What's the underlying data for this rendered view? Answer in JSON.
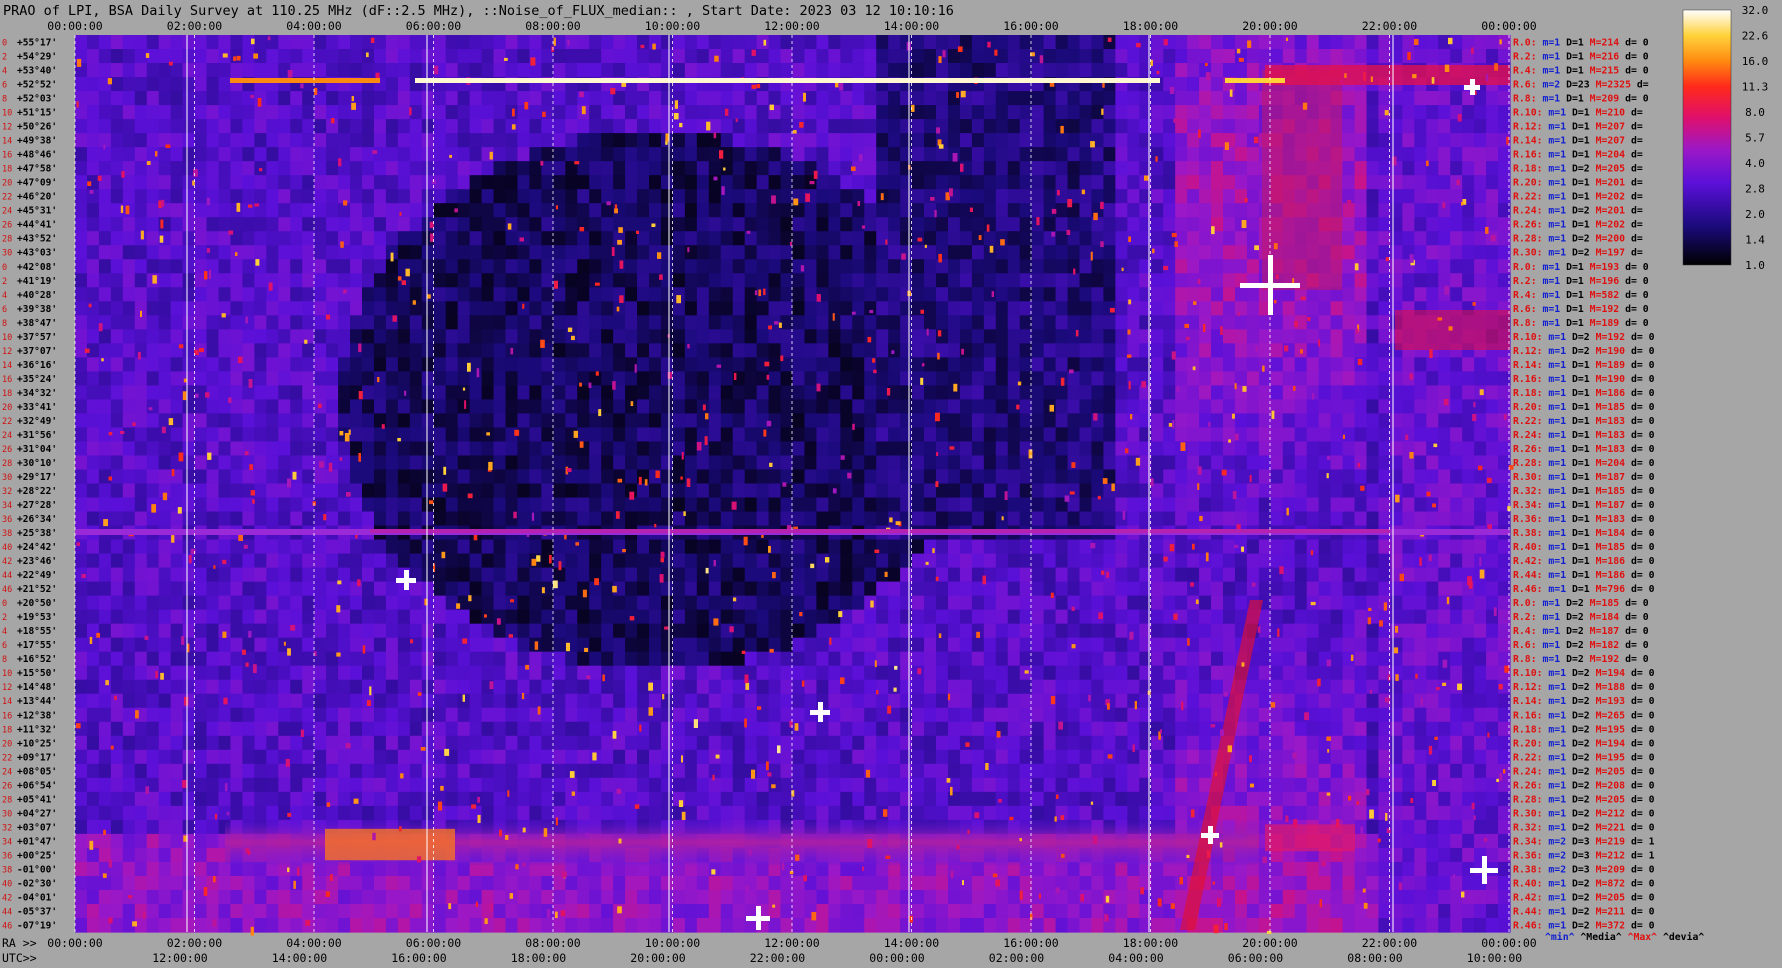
{
  "title": "PRAO of LPI, BSA Daily Survey at 110.25 MHz (dF::2.5 MHz), ::Noise_of_FLUX_median:: , Start Date: 2023 03 12 10:10:16",
  "chart_data": {
    "type": "heatmap",
    "title": "PRAO of LPI, BSA Daily Survey at 110.25 MHz (dF::2.5 MHz), ::Noise_of_FLUX_median:: , Start Date: 2023 03 12 10:10:16",
    "x_top_ticks": [
      "00:00:00",
      "02:00:00",
      "04:00:00",
      "06:00:00",
      "08:00:00",
      "10:00:00",
      "12:00:00",
      "14:00:00",
      "16:00:00",
      "18:00:00",
      "20:00:00",
      "22:00:00",
      "00:00:00"
    ],
    "x_ra_label": "RA >>",
    "x_ra_ticks": [
      "00:00:00",
      "02:00:00",
      "04:00:00",
      "06:00:00",
      "08:00:00",
      "10:00:00",
      "12:00:00",
      "14:00:00",
      "16:00:00",
      "18:00:00",
      "20:00:00",
      "22:00:00",
      "00:00:00"
    ],
    "x_utc_label": "UTC>>",
    "x_utc_ticks": [
      "12:00:00",
      "14:00:00",
      "16:00:00",
      "18:00:00",
      "20:00:00",
      "22:00:00",
      "00:00:00",
      "02:00:00",
      "04:00:00",
      "06:00:00",
      "08:00:00",
      "10:00:00"
    ],
    "y_labels": [
      "+55°17'",
      "+54°29'",
      "+53°40'",
      "+52°52'",
      "+52°03'",
      "+51°15'",
      "+50°26'",
      "+49°38'",
      "+48°46'",
      "+47°58'",
      "+47°09'",
      "+46°20'",
      "+45°31'",
      "+44°41'",
      "+43°52'",
      "+43°03'",
      "+42°08'",
      "+41°19'",
      "+40°28'",
      "+39°38'",
      "+38°47'",
      "+37°57'",
      "+37°07'",
      "+36°16'",
      "+35°24'",
      "+34°32'",
      "+33°41'",
      "+32°49'",
      "+31°56'",
      "+31°04'",
      "+30°10'",
      "+29°17'",
      "+28°22'",
      "+27°28'",
      "+26°34'",
      "+25°38'",
      "+24°42'",
      "+23°46'",
      "+22°49'",
      "+21°52'",
      "+20°50'",
      "+19°53'",
      "+18°55'",
      "+17°55'",
      "+16°52'",
      "+15°50'",
      "+14°48'",
      "+13°44'",
      "+12°38'",
      "+11°32'",
      "+10°25'",
      "+09°17'",
      "+08°05'",
      "+06°54'",
      "+05°41'",
      "+04°27'",
      "+03°07'",
      "+01°47'",
      "+00°25'",
      "-01°00'",
      "-02°30'",
      "-04°01'",
      "-05°37'",
      "-07°19'"
    ],
    "row_indices": [
      "0",
      "2",
      "4",
      "6",
      "8",
      "10",
      "12",
      "14",
      "16",
      "18",
      "20",
      "22",
      "24",
      "26",
      "28",
      "30",
      "0",
      "2",
      "4",
      "6",
      "8",
      "10",
      "12",
      "14",
      "16",
      "18",
      "20",
      "22",
      "24",
      "26",
      "28",
      "30",
      "32",
      "34",
      "36",
      "38",
      "40",
      "42",
      "44",
      "46",
      "0",
      "2",
      "4",
      "6",
      "8",
      "10",
      "12",
      "14",
      "16",
      "18",
      "20",
      "22",
      "24",
      "26",
      "28",
      "30",
      "32",
      "34",
      "36",
      "38",
      "40",
      "42",
      "44",
      "46"
    ],
    "side_table": [
      {
        "r": "R.0:",
        "m": "m=1",
        "d": "D=1",
        "M": "M=214",
        "dv": "d= 0"
      },
      {
        "r": "R.2:",
        "m": "m=1",
        "d": "D=1",
        "M": "M=216",
        "dv": "d= 0"
      },
      {
        "r": "R.4:",
        "m": "m=1",
        "d": "D=1",
        "M": "M=215",
        "dv": "d= 0"
      },
      {
        "r": "R.6:",
        "m": "m=2",
        "d": "D=23",
        "M": "M=2325",
        "dv": "d="
      },
      {
        "r": "R.8:",
        "m": "m=1",
        "d": "D=1",
        "M": "M=209",
        "dv": "d= 0"
      },
      {
        "r": "R.10:",
        "m": "m=1",
        "d": "D=1",
        "M": "M=210",
        "dv": "d="
      },
      {
        "r": "R.12:",
        "m": "m=1",
        "d": "D=1",
        "M": "M=207",
        "dv": "d="
      },
      {
        "r": "R.14:",
        "m": "m=1",
        "d": "D=1",
        "M": "M=207",
        "dv": "d="
      },
      {
        "r": "R.16:",
        "m": "m=1",
        "d": "D=1",
        "M": "M=204",
        "dv": "d="
      },
      {
        "r": "R.18:",
        "m": "m=1",
        "d": "D=2",
        "M": "M=205",
        "dv": "d="
      },
      {
        "r": "R.20:",
        "m": "m=1",
        "d": "D=1",
        "M": "M=201",
        "dv": "d="
      },
      {
        "r": "R.22:",
        "m": "m=1",
        "d": "D=1",
        "M": "M=202",
        "dv": "d="
      },
      {
        "r": "R.24:",
        "m": "m=1",
        "d": "D=2",
        "M": "M=201",
        "dv": "d="
      },
      {
        "r": "R.26:",
        "m": "m=1",
        "d": "D=1",
        "M": "M=202",
        "dv": "d="
      },
      {
        "r": "R.28:",
        "m": "m=1",
        "d": "D=2",
        "M": "M=200",
        "dv": "d="
      },
      {
        "r": "R.30:",
        "m": "m=1",
        "d": "D=2",
        "M": "M=197",
        "dv": "d="
      },
      {
        "r": "R.0:",
        "m": "m=1",
        "d": "D=1",
        "M": "M=193",
        "dv": "d= 0"
      },
      {
        "r": "R.2:",
        "m": "m=1",
        "d": "D=1",
        "M": "M=196",
        "dv": "d= 0"
      },
      {
        "r": "R.4:",
        "m": "m=1",
        "d": "D=1",
        "M": "M=582",
        "dv": "d= 0"
      },
      {
        "r": "R.6:",
        "m": "m=1",
        "d": "D=1",
        "M": "M=192",
        "dv": "d= 0"
      },
      {
        "r": "R.8:",
        "m": "m=1",
        "d": "D=1",
        "M": "M=189",
        "dv": "d= 0"
      },
      {
        "r": "R.10:",
        "m": "m=1",
        "d": "D=2",
        "M": "M=192",
        "dv": "d= 0"
      },
      {
        "r": "R.12:",
        "m": "m=1",
        "d": "D=2",
        "M": "M=190",
        "dv": "d= 0"
      },
      {
        "r": "R.14:",
        "m": "m=1",
        "d": "D=1",
        "M": "M=189",
        "dv": "d= 0"
      },
      {
        "r": "R.16:",
        "m": "m=1",
        "d": "D=1",
        "M": "M=190",
        "dv": "d= 0"
      },
      {
        "r": "R.18:",
        "m": "m=1",
        "d": "D=1",
        "M": "M=186",
        "dv": "d= 0"
      },
      {
        "r": "R.20:",
        "m": "m=1",
        "d": "D=1",
        "M": "M=185",
        "dv": "d= 0"
      },
      {
        "r": "R.22:",
        "m": "m=1",
        "d": "D=1",
        "M": "M=183",
        "dv": "d= 0"
      },
      {
        "r": "R.24:",
        "m": "m=1",
        "d": "D=1",
        "M": "M=183",
        "dv": "d= 0"
      },
      {
        "r": "R.26:",
        "m": "m=1",
        "d": "D=1",
        "M": "M=183",
        "dv": "d= 0"
      },
      {
        "r": "R.28:",
        "m": "m=1",
        "d": "D=1",
        "M": "M=204",
        "dv": "d= 0"
      },
      {
        "r": "R.30:",
        "m": "m=1",
        "d": "D=1",
        "M": "M=187",
        "dv": "d= 0"
      },
      {
        "r": "R.32:",
        "m": "m=1",
        "d": "D=1",
        "M": "M=185",
        "dv": "d= 0"
      },
      {
        "r": "R.34:",
        "m": "m=1",
        "d": "D=1",
        "M": "M=187",
        "dv": "d= 0"
      },
      {
        "r": "R.36:",
        "m": "m=1",
        "d": "D=1",
        "M": "M=183",
        "dv": "d= 0"
      },
      {
        "r": "R.38:",
        "m": "m=1",
        "d": "D=1",
        "M": "M=184",
        "dv": "d= 0"
      },
      {
        "r": "R.40:",
        "m": "m=1",
        "d": "D=1",
        "M": "M=185",
        "dv": "d= 0"
      },
      {
        "r": "R.42:",
        "m": "m=1",
        "d": "D=1",
        "M": "M=186",
        "dv": "d= 0"
      },
      {
        "r": "R.44:",
        "m": "m=1",
        "d": "D=1",
        "M": "M=186",
        "dv": "d= 0"
      },
      {
        "r": "R.46:",
        "m": "m=1",
        "d": "D=1",
        "M": "M=796",
        "dv": "d= 0"
      },
      {
        "r": "R.0:",
        "m": "m=1",
        "d": "D=2",
        "M": "M=185",
        "dv": "d= 0"
      },
      {
        "r": "R.2:",
        "m": "m=1",
        "d": "D=2",
        "M": "M=184",
        "dv": "d= 0"
      },
      {
        "r": "R.4:",
        "m": "m=1",
        "d": "D=2",
        "M": "M=187",
        "dv": "d= 0"
      },
      {
        "r": "R.6:",
        "m": "m=1",
        "d": "D=2",
        "M": "M=182",
        "dv": "d= 0"
      },
      {
        "r": "R.8:",
        "m": "m=1",
        "d": "D=2",
        "M": "M=192",
        "dv": "d= 0"
      },
      {
        "r": "R.10:",
        "m": "m=1",
        "d": "D=2",
        "M": "M=194",
        "dv": "d= 0"
      },
      {
        "r": "R.12:",
        "m": "m=1",
        "d": "D=2",
        "M": "M=188",
        "dv": "d= 0"
      },
      {
        "r": "R.14:",
        "m": "m=1",
        "d": "D=2",
        "M": "M=193",
        "dv": "d= 0"
      },
      {
        "r": "R.16:",
        "m": "m=1",
        "d": "D=2",
        "M": "M=265",
        "dv": "d= 0"
      },
      {
        "r": "R.18:",
        "m": "m=1",
        "d": "D=2",
        "M": "M=195",
        "dv": "d= 0"
      },
      {
        "r": "R.20:",
        "m": "m=1",
        "d": "D=2",
        "M": "M=194",
        "dv": "d= 0"
      },
      {
        "r": "R.22:",
        "m": "m=1",
        "d": "D=2",
        "M": "M=195",
        "dv": "d= 0"
      },
      {
        "r": "R.24:",
        "m": "m=1",
        "d": "D=2",
        "M": "M=205",
        "dv": "d= 0"
      },
      {
        "r": "R.26:",
        "m": "m=1",
        "d": "D=2",
        "M": "M=208",
        "dv": "d= 0"
      },
      {
        "r": "R.28:",
        "m": "m=1",
        "d": "D=2",
        "M": "M=205",
        "dv": "d= 0"
      },
      {
        "r": "R.30:",
        "m": "m=1",
        "d": "D=2",
        "M": "M=212",
        "dv": "d= 0"
      },
      {
        "r": "R.32:",
        "m": "m=1",
        "d": "D=2",
        "M": "M=221",
        "dv": "d= 0"
      },
      {
        "r": "R.34:",
        "m": "m=2",
        "d": "D=3",
        "M": "M=219",
        "dv": "d= 1"
      },
      {
        "r": "R.36:",
        "m": "m=2",
        "d": "D=3",
        "M": "M=212",
        "dv": "d= 1"
      },
      {
        "r": "R.38:",
        "m": "m=2",
        "d": "D=3",
        "M": "M=209",
        "dv": "d= 0"
      },
      {
        "r": "R.40:",
        "m": "m=1",
        "d": "D=2",
        "M": "M=872",
        "dv": "d= 0"
      },
      {
        "r": "R.42:",
        "m": "m=1",
        "d": "D=2",
        "M": "M=205",
        "dv": "d= 0"
      },
      {
        "r": "R.44:",
        "m": "m=1",
        "d": "D=2",
        "M": "M=211",
        "dv": "d= 0"
      },
      {
        "r": "R.46:",
        "m": "m=1",
        "d": "D=2",
        "M": "M=372",
        "dv": "d= 0"
      }
    ],
    "side_footer": [
      "^min^",
      "^Media^",
      "^Max^",
      "^devia^"
    ],
    "colorbar": {
      "ticks": [
        "32.0",
        "22.6",
        "16.0",
        "11.3",
        "8.0",
        "5.7",
        "4.0",
        "2.8",
        "2.0",
        "1.4",
        "1.0"
      ],
      "range": [
        1.0,
        32.0
      ],
      "scale": "log2"
    },
    "features": {
      "strong_rfi_row_dec": "+52°52'",
      "horizontal_band_dec": "+25°38'",
      "bright_source_ra": "19:56",
      "bright_source_dec": "+40°44'",
      "bright_source_ra_2": "23:23",
      "bright_source_dec_2": "+58°48'"
    }
  },
  "colors": {
    "background": "#a6a6a6",
    "row_index": "#d01010",
    "side_R": "#e01010",
    "side_m": "#1020d0",
    "side_M": "#e01010",
    "footer_min": "#1020d0",
    "footer_max": "#e01010"
  }
}
